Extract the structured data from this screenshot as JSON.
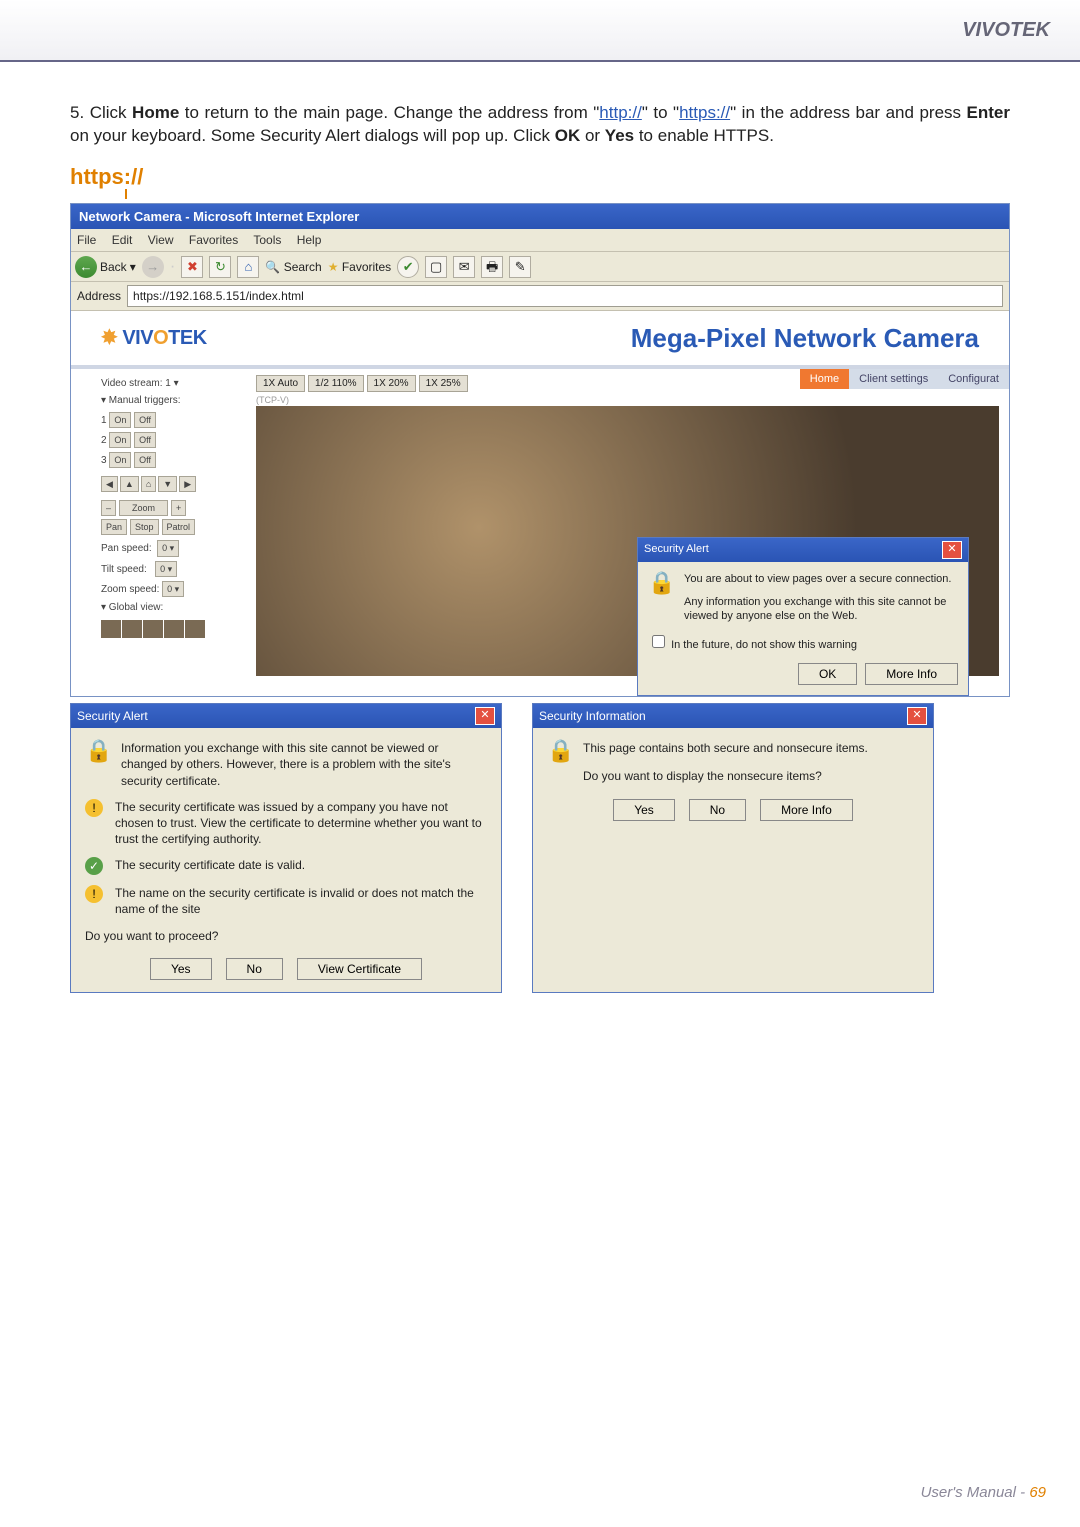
{
  "header": {
    "brand": "VIVOTEK"
  },
  "step": {
    "num": "5.",
    "pre": "Click ",
    "home": "Home",
    "mid1": " to return to the main page. Change the address from \"",
    "http": "http://",
    "mid2": "\" to \"",
    "https": "https://",
    "mid3": "\" in the address bar and press ",
    "enter": "Enter",
    "mid4": " on your keyboard. Some Security Alert dialogs will pop up. Click ",
    "ok": "OK",
    "or": " or ",
    "yes": "Yes",
    "end": " to enable HTTPS."
  },
  "https_label": "https://",
  "browser": {
    "title": "Network Camera - Microsoft Internet Explorer",
    "menu": [
      "File",
      "Edit",
      "View",
      "Favorites",
      "Tools",
      "Help"
    ],
    "back": "Back",
    "search": "Search",
    "favorites": "Favorites",
    "addr_label": "Address",
    "addr_value": "https://192.168.5.151/index.html"
  },
  "cam": {
    "logo_pre": "VIV",
    "logo_o": "O",
    "logo_post": "TEK",
    "title": "Mega-Pixel Network Camera",
    "video_stream": "Video stream:  1   ▾",
    "manual_triggers": "▾ Manual triggers:",
    "t1": "1",
    "t2": "2",
    "t3": "3",
    "on": "On",
    "off": "Off",
    "zoom": "Zoom",
    "plus": "+",
    "minus": "–",
    "pan": "Pan",
    "stop": "Stop",
    "patrol": "Patrol",
    "pan_speed": "Pan speed:",
    "tilt_speed": "Tilt speed:",
    "zoom_speed": "Zoom speed:",
    "zero": "0   ▾",
    "global": "▾ Global view:",
    "tab1": "1X Auto",
    "tab2": "1/2 110%",
    "tab3": "1X 20%",
    "tab4": "1X 25%",
    "tcp": "(TCP-V)",
    "nav_home": "Home",
    "nav_cs": "Client settings",
    "nav_cfg": "Configurat"
  },
  "alert1": {
    "title": "Security Alert",
    "x": "✕",
    "msg1": "You are about to view pages over a secure connection.",
    "msg2": "Any information you exchange with this site cannot be viewed by anyone else on the Web.",
    "chk": "In the future, do not show this warning",
    "ok": "OK",
    "more": "More Info"
  },
  "alert2": {
    "title": "Security Alert",
    "msg": "Information you exchange with this site cannot be viewed or changed by others. However, there is a problem with the site's security certificate.",
    "c1": "The security certificate was issued by a company you have not chosen to trust. View the certificate to determine whether you want to trust the certifying authority.",
    "c2": "The security certificate date is valid.",
    "c3": "The name on the security certificate is invalid or does not match the name of the site",
    "q": "Do you want to proceed?",
    "yes": "Yes",
    "no": "No",
    "view": "View Certificate"
  },
  "alert3": {
    "title": "Security Information",
    "msg": "This page contains both secure and nonsecure items.",
    "q": "Do you want to display the nonsecure items?",
    "yes": "Yes",
    "no": "No",
    "more": "More Info"
  },
  "footer": {
    "label": "User's Manual - ",
    "page": "69"
  }
}
